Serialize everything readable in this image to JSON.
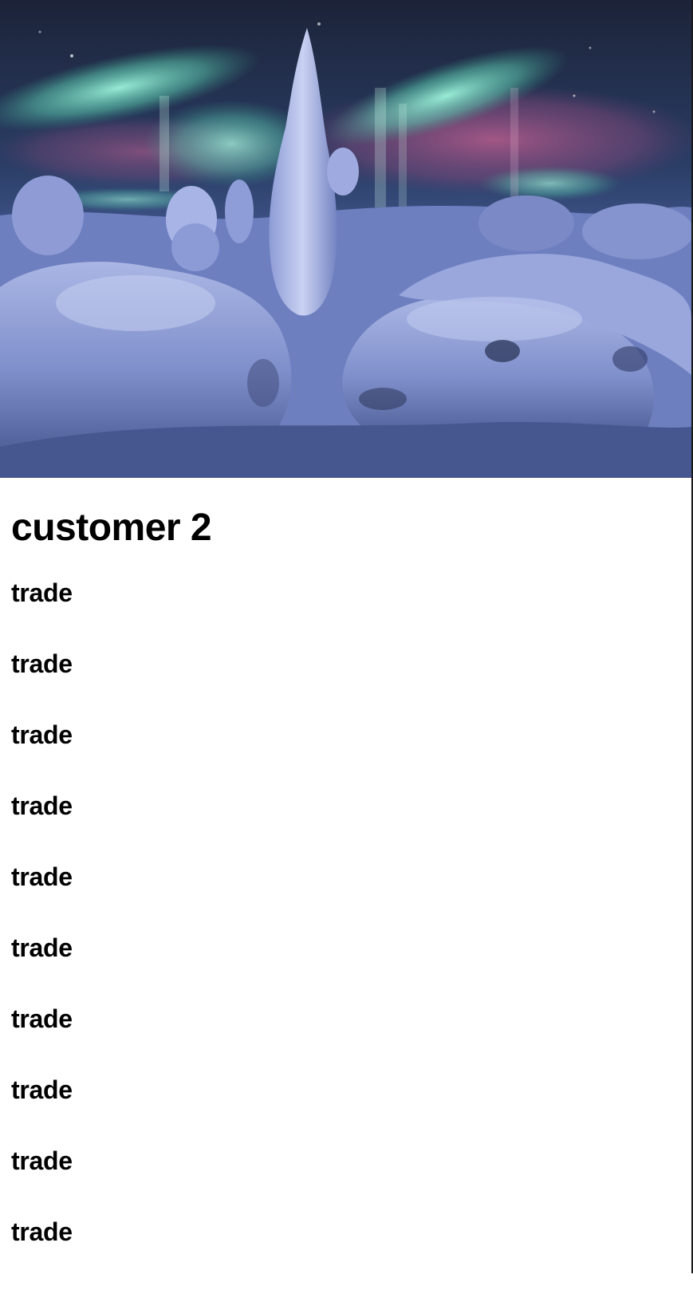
{
  "hero": {
    "alt": "Aurora borealis over snow-covered trees at night"
  },
  "title": "customer 2",
  "trades": [
    {
      "label": "trade"
    },
    {
      "label": "trade"
    },
    {
      "label": "trade"
    },
    {
      "label": "trade"
    },
    {
      "label": "trade"
    },
    {
      "label": "trade"
    },
    {
      "label": "trade"
    },
    {
      "label": "trade"
    },
    {
      "label": "trade"
    },
    {
      "label": "trade"
    }
  ]
}
